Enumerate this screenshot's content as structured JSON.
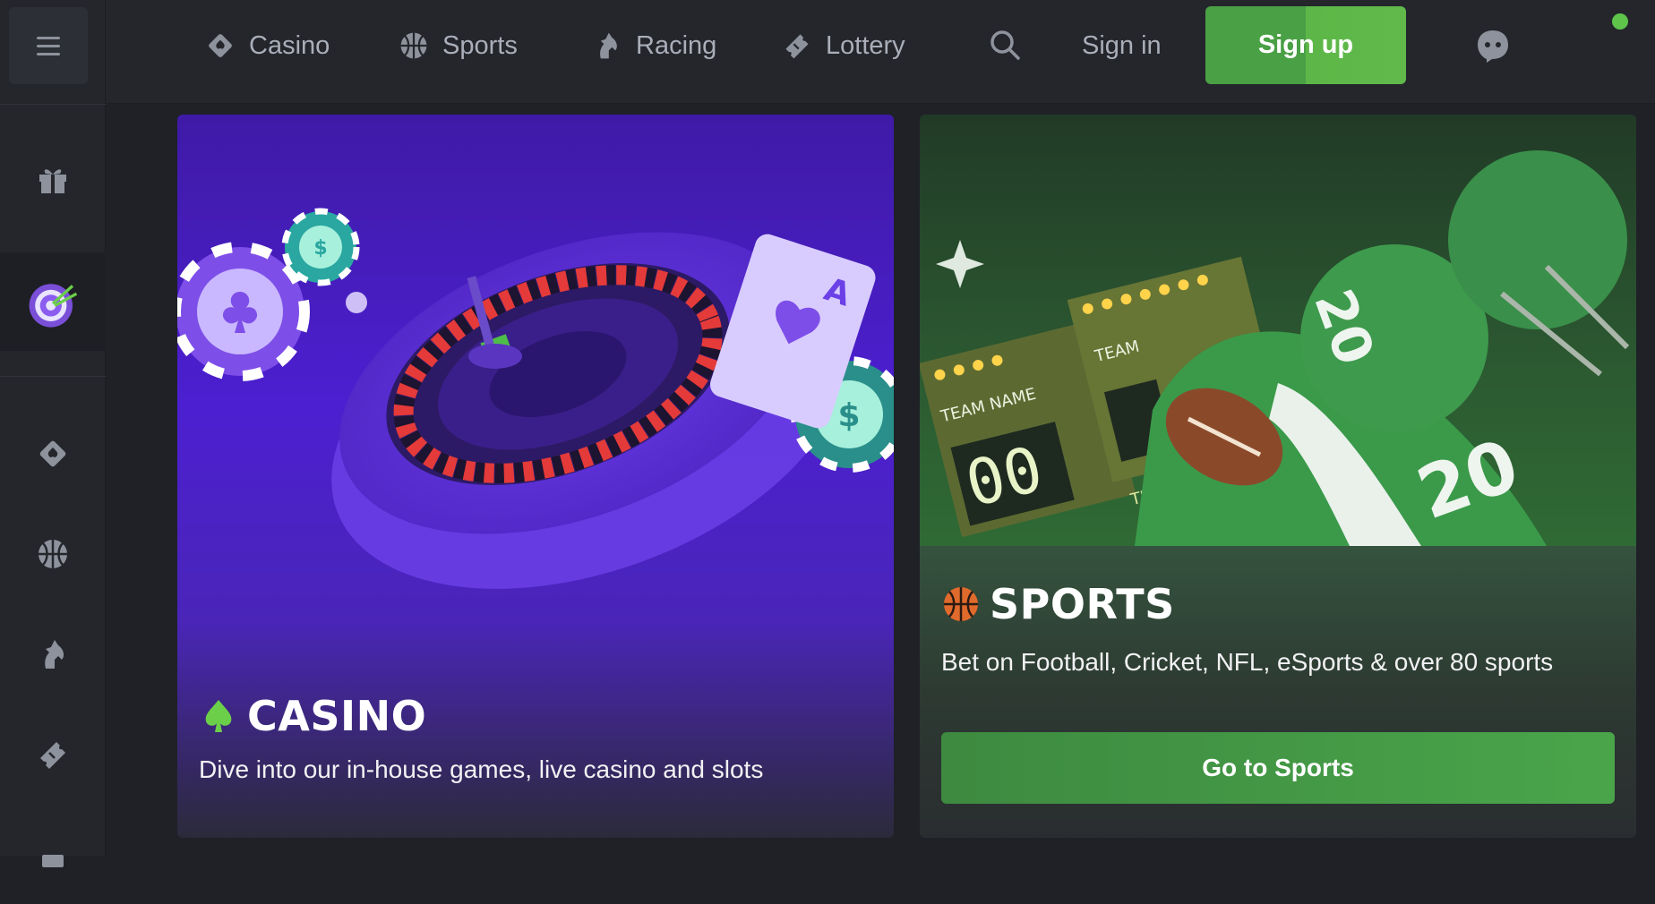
{
  "nav": {
    "items": [
      {
        "label": "Casino",
        "icon": "casino-card-icon"
      },
      {
        "label": "Sports",
        "icon": "basketball-icon"
      },
      {
        "label": "Racing",
        "icon": "horse-icon"
      },
      {
        "label": "Lottery",
        "icon": "ticket-icon"
      }
    ],
    "sign_in": "Sign in",
    "sign_up": "Sign up"
  },
  "sidebar": {
    "items": [
      "menu-icon",
      "gift-icon",
      "dartboard-icon",
      "casino-card-icon",
      "basketball-icon",
      "horse-icon",
      "ticket-icon"
    ]
  },
  "casino": {
    "title": "CASINO",
    "description": "Dive into our in-house games, live casino and slots",
    "art_text": {
      "ace": "A"
    }
  },
  "sports": {
    "title": "SPORTS",
    "description": "Bet on Football, Cricket, NFL, eSports & over 80 sports",
    "button": "Go to Sports",
    "art_text": {
      "team_name": "TEAM NAME",
      "team": "TEAM",
      "time": "TIME",
      "score": "00",
      "jersey": "20"
    }
  },
  "colors": {
    "brand_green": "#4aa045",
    "casino_purple": "#4c1fd0",
    "status_online": "#5ec44a"
  }
}
